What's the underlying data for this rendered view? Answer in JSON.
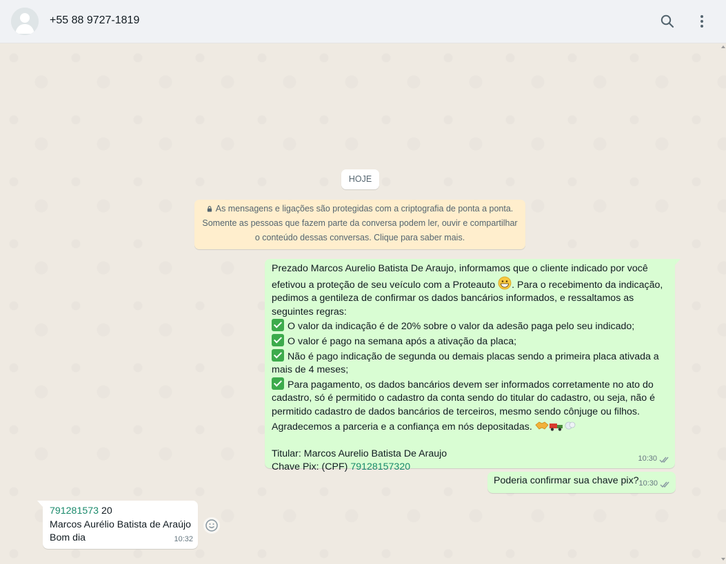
{
  "header": {
    "contact_name": "+55 88 9727-1819",
    "icons": [
      "default-avatar",
      "search-icon",
      "menu-dots-icon"
    ]
  },
  "chat": {
    "date_chip": "HOJE",
    "encryption_notice": {
      "line1": "As mensagens e ligações são protegidas com a criptografia de ponta a ponta.",
      "line2": "Somente as pessoas que fazem parte da conversa podem ler, ouvir e compartilhar",
      "line3": "o conteúdo dessas conversas. Clique para saber mais."
    },
    "messages": [
      {
        "direction": "outgoing",
        "lines": {
          "l1": "Prezado Marcos Aurelio Batista De Araujo, informamos que o cliente indicado por você",
          "l2a": "efetivou a proteção de seu veículo com a Proteauto",
          "l2b": ". Para o recebimento da indicação,",
          "l3": "pedimos a gentileza de confirmar os dados bancários informados, e  ressaltamos as",
          "l4": "seguintes regras:",
          "r1": "O valor da indicação é de 20% sobre o valor da adesão paga pelo seu indicado;",
          "r2": "O valor é pago na semana após a ativação da placa;",
          "r3a": "Não é pago indicação de segunda ou demais placas sendo a primeira placa ativada a",
          "r3b": "mais de 4 meses;",
          "r4a": "Para pagamento, os dados bancários devem ser informados corretamente no ato do",
          "r4b": "cadastro, só é permitido o cadastro da conta sendo do titular do cadastro, ou seja, não é",
          "r4c": "permitido cadastro de dados bancários de terceiros, mesmo sendo cônjuge ou filhos.",
          "thanks": "Agradecemos a parceria e a confiança em nós depositadas.",
          "titular": "Titular: Marcos Aurelio Batista De Araujo",
          "pix_label": "Chave Pix: (CPF) ",
          "pix_value": "79128157320"
        },
        "time": "10:30",
        "status": "delivered"
      },
      {
        "direction": "outgoing",
        "text": "Poderia confirmar sua chave pix?",
        "time": "10:30",
        "status": "delivered"
      },
      {
        "direction": "incoming",
        "link_text": "791281573",
        "after_link": " 20",
        "line2": "Marcos Aurélio Batista de Araújo",
        "line3": "Bom dia",
        "time": "10:32"
      }
    ]
  },
  "colors": {
    "chat_bg": "#efeae2",
    "outgoing_bubble": "#d9fdd3",
    "incoming_bubble": "#ffffff",
    "notice_bg": "#ffeecd",
    "link": "#1a8a6b",
    "check_green": "#3dab4c"
  }
}
